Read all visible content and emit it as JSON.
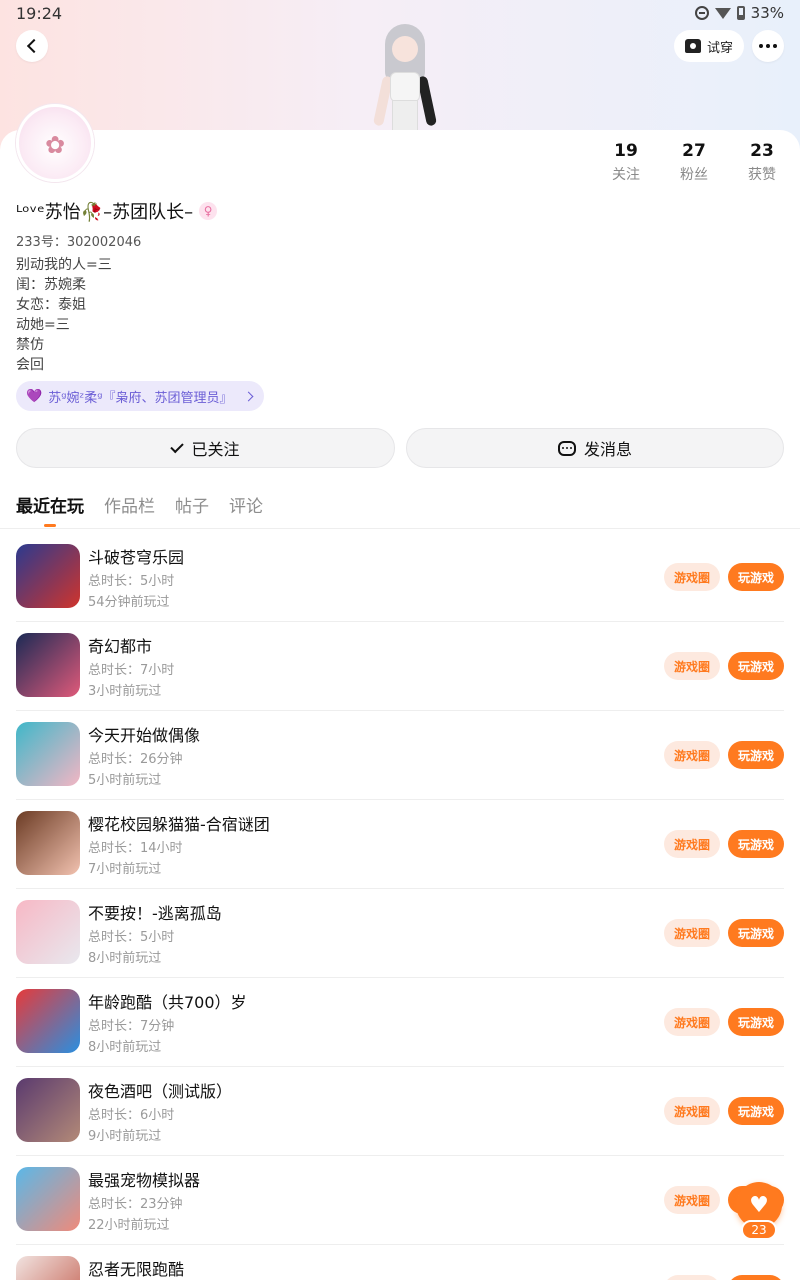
{
  "status": {
    "time": "19:24",
    "battery": "33%"
  },
  "header": {
    "tryon_label": "试穿"
  },
  "profile": {
    "name": "ᴸᵒᵛᵉ苏怡🥀–苏团队长–",
    "gender_symbol": "♀",
    "uid": "233号：302002046",
    "bio": [
      "别动我的人=三",
      "闺：苏婉柔",
      "女恋：泰姐",
      "动她=三",
      "禁仿",
      "会回"
    ],
    "club_tag": "苏ᵍ婉ᶻ柔ᵍ『枭府、苏团管理员』"
  },
  "stats": [
    {
      "num": "19",
      "label": "关注"
    },
    {
      "num": "27",
      "label": "粉丝"
    },
    {
      "num": "23",
      "label": "获赞"
    }
  ],
  "actions": {
    "follow": "已关注",
    "message": "发消息"
  },
  "tabs": [
    "最近在玩",
    "作品栏",
    "帖子",
    "评论"
  ],
  "circle_label": "游戏圈",
  "play_label": "玩游戏",
  "games": [
    {
      "title": "斗破苍穹乐园",
      "duration": "总时长：5小时",
      "last": "54分钟前玩过",
      "colors": [
        "#2b3a8f",
        "#d0342c"
      ]
    },
    {
      "title": "奇幻都市",
      "duration": "总时长：7小时",
      "last": "3小时前玩过",
      "colors": [
        "#1b2a55",
        "#e05a7a"
      ]
    },
    {
      "title": "今天开始做偶像",
      "duration": "总时长：26分钟",
      "last": "5小时前玩过",
      "colors": [
        "#3fb7c9",
        "#f3b6c4"
      ]
    },
    {
      "title": "樱花校园躲猫猫-合宿谜团",
      "duration": "总时长：14小时",
      "last": "7小时前玩过",
      "colors": [
        "#6b3b24",
        "#f2c2b0"
      ]
    },
    {
      "title": "不要按！-逃离孤岛",
      "duration": "总时长：5小时",
      "last": "8小时前玩过",
      "colors": [
        "#f7b8c5",
        "#e8e8ee"
      ]
    },
    {
      "title": "年龄跑酷（共700）岁",
      "duration": "总时长：7分钟",
      "last": "8小时前玩过",
      "colors": [
        "#e63a3a",
        "#2a8fe0"
      ]
    },
    {
      "title": "夜色酒吧（测试版）",
      "duration": "总时长：6小时",
      "last": "9小时前玩过",
      "colors": [
        "#5a3a6e",
        "#b38a78"
      ]
    },
    {
      "title": "最强宠物模拟器",
      "duration": "总时长：23分钟",
      "last": "22小时前玩过",
      "colors": [
        "#5ab8e8",
        "#f08a7a"
      ]
    },
    {
      "title": "忍者无限跑酷",
      "duration": "",
      "last": "",
      "colors": [
        "#f1e3e0",
        "#c25a4a"
      ]
    }
  ],
  "like_count": "23"
}
